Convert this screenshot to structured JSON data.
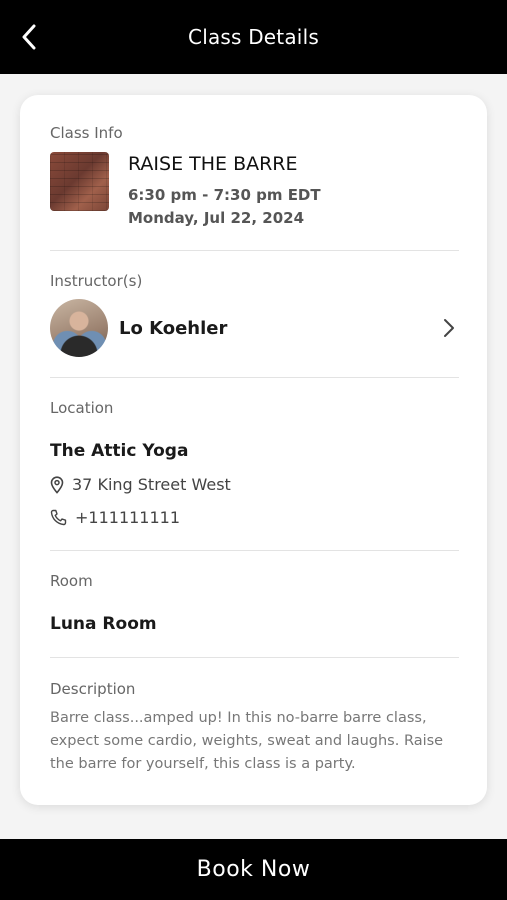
{
  "header": {
    "title": "Class Details",
    "back_icon": "chevron-left-icon"
  },
  "class_info": {
    "label": "Class Info",
    "name": "RAISE THE BARRE",
    "time": "6:30 pm - 7:30 pm EDT",
    "date": "Monday, Jul 22, 2024"
  },
  "instructors": {
    "label": "Instructor(s)",
    "name": "Lo Koehler",
    "chevron_icon": "chevron-right-icon"
  },
  "location": {
    "label": "Location",
    "name": "The Attic Yoga",
    "address": "37 King Street West",
    "phone": "+111111111",
    "address_icon": "map-pin-icon",
    "phone_icon": "phone-icon"
  },
  "room": {
    "label": "Room",
    "name": "Luna Room"
  },
  "description": {
    "label": "Description",
    "text": "Barre class...amped up! In this no-barre barre class, expect some cardio, weights, sweat and laughs. Raise the barre for yourself, this class is a party."
  },
  "footer": {
    "book_label": "Book Now"
  },
  "colors": {
    "header_bg": "#000000",
    "card_bg": "#ffffff",
    "page_bg": "#f4f4f4",
    "button_bg": "#000000"
  }
}
